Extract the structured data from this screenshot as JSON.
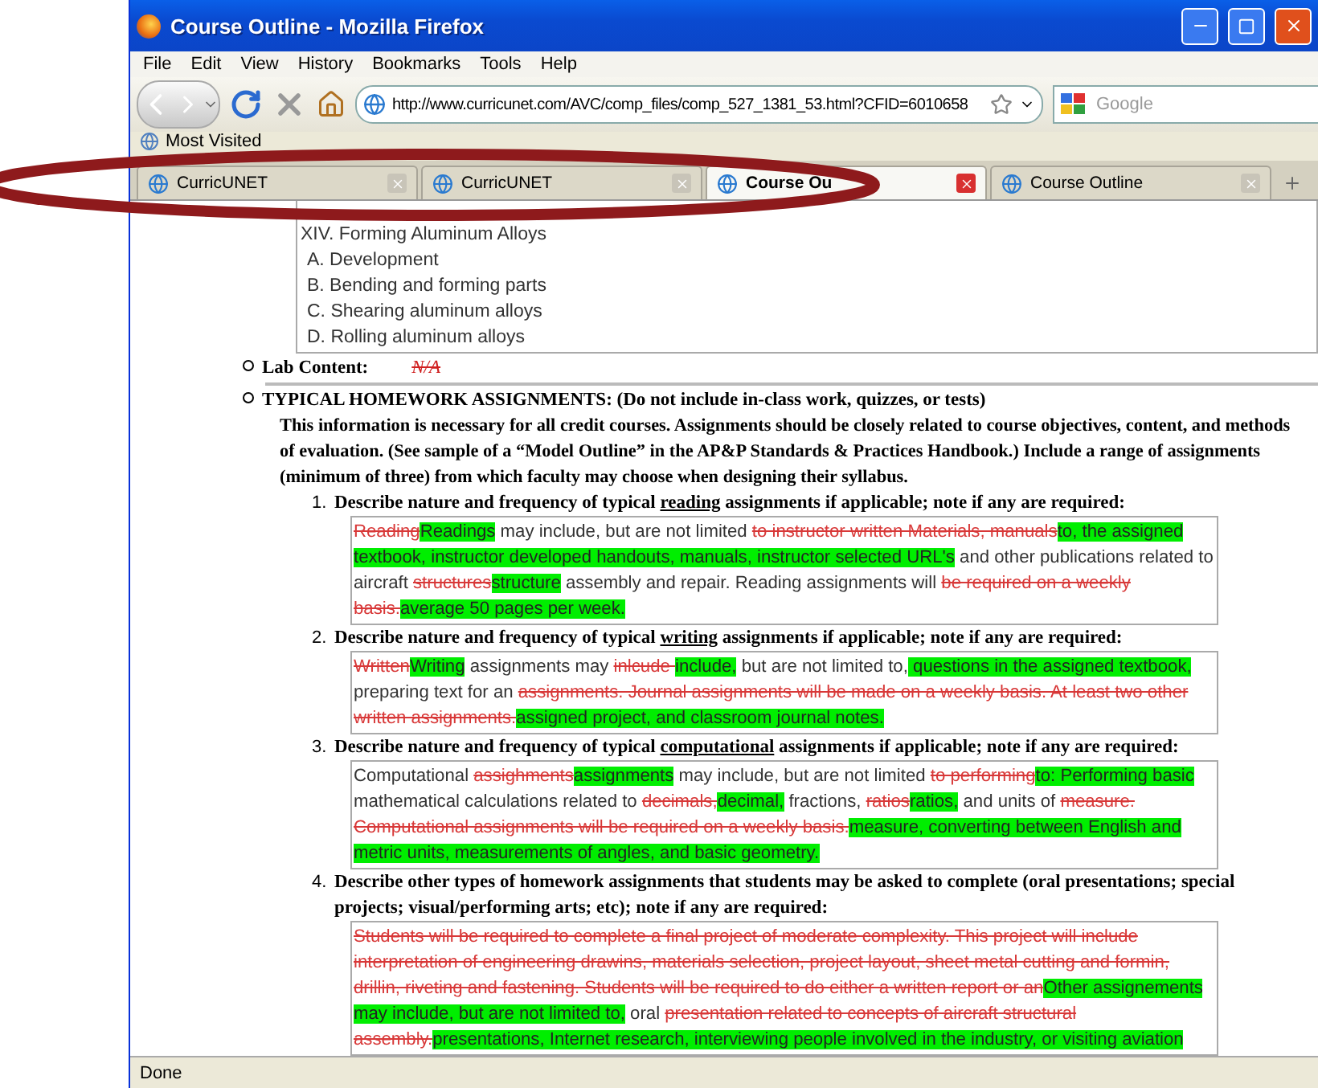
{
  "window": {
    "title": "Course Outline - Mozilla Firefox"
  },
  "menu": [
    "File",
    "Edit",
    "View",
    "History",
    "Bookmarks",
    "Tools",
    "Help"
  ],
  "address": {
    "value": "http://www.curricunet.com/AVC/comp_files/comp_527_1381_53.html?CFID=6010658"
  },
  "search": {
    "placeholder": "Google"
  },
  "bookmarks": [
    "Most Visited"
  ],
  "tabs": [
    {
      "label": "CurricUNET",
      "selected": false
    },
    {
      "label": "CurricUNET",
      "selected": false
    },
    {
      "label": "Course Ou",
      "selected": true
    },
    {
      "label": "Course Outline",
      "selected": false
    }
  ],
  "outline": [
    {
      "text": "XIV. Forming Aluminum Alloys",
      "kind": "main"
    },
    {
      "text": "A. Development",
      "kind": "sub"
    },
    {
      "text": "B. Bending and forming parts",
      "kind": "sub"
    },
    {
      "text": "C. Shearing aluminum alloys",
      "kind": "sub"
    },
    {
      "text": "D. Rolling aluminum alloys",
      "kind": "sub"
    }
  ],
  "lab": {
    "label": "Lab Content:",
    "value": "N/A"
  },
  "homework": {
    "heading": "TYPICAL HOMEWORK ASSIGNMENTS: (Do not include in-class work, quizzes, or tests)",
    "intro": "This information is necessary for all credit courses. Assignments should be closely related to course objectives, content, and methods of evaluation. (See sample of a “Model Outline” in the AP&P Standards & Practices Handbook.) Include a range of assignments (minimum of three) from which faculty may choose when designing their syllabus.",
    "questions": [
      {
        "number": "1.",
        "prompt": [
          {
            "text": "Describe nature and frequency of typical ",
            "underlined": false
          },
          {
            "text": "reading",
            "underlined": true
          },
          {
            "text": " assignments if applicable; note if any are required:",
            "underlined": false
          }
        ],
        "answer": [
          {
            "kind": "del",
            "text": "Reading"
          },
          {
            "kind": "ins",
            "text": "Readings"
          },
          {
            "kind": "plain",
            "text": " may include, but are not limited "
          },
          {
            "kind": "del",
            "text": "to instructor written Materials, manuals"
          },
          {
            "kind": "ins",
            "text": "to, the assigned textbook, instructor developed handouts, manuals, instructor selected URL's"
          },
          {
            "kind": "plain",
            "text": " and other publications related to aircraft "
          },
          {
            "kind": "del",
            "text": "structures"
          },
          {
            "kind": "ins",
            "text": "structure"
          },
          {
            "kind": "plain",
            "text": " assembly and repair. Reading assignments will "
          },
          {
            "kind": "del",
            "text": "be required on a weekly basis."
          },
          {
            "kind": "ins",
            "text": "average 50 pages per week."
          }
        ]
      },
      {
        "number": "2.",
        "prompt": [
          {
            "text": "Describe nature and frequency of typical ",
            "underlined": false
          },
          {
            "text": "writing",
            "underlined": true
          },
          {
            "text": " assignments if applicable; note if any are required:",
            "underlined": false
          }
        ],
        "answer": [
          {
            "kind": "del",
            "text": "Written"
          },
          {
            "kind": "ins",
            "text": "Writing"
          },
          {
            "kind": "plain",
            "text": " assignments may "
          },
          {
            "kind": "del",
            "text": "inlcude "
          },
          {
            "kind": "ins",
            "text": "include,"
          },
          {
            "kind": "plain",
            "text": " but are not limited to,"
          },
          {
            "kind": "ins",
            "text": " questions in the assigned textbook,"
          },
          {
            "kind": "plain",
            "text": " preparing text for an "
          },
          {
            "kind": "del",
            "text": "assignments. Journal assignments will be made on a weekly basis. At least two other written assignments."
          },
          {
            "kind": "ins",
            "text": "assigned project, and classroom journal notes."
          }
        ]
      },
      {
        "number": "3.",
        "prompt": [
          {
            "text": "Describe nature and frequency of typical ",
            "underlined": false
          },
          {
            "text": "computational",
            "underlined": true
          },
          {
            "text": " assignments if applicable; note if any are required:",
            "underlined": false
          }
        ],
        "answer": [
          {
            "kind": "plain",
            "text": "Computational "
          },
          {
            "kind": "del",
            "text": "assighments"
          },
          {
            "kind": "ins",
            "text": "assignments"
          },
          {
            "kind": "plain",
            "text": " may include, but are not limited "
          },
          {
            "kind": "del",
            "text": "to performing"
          },
          {
            "kind": "ins",
            "text": "to: Performing basic"
          },
          {
            "kind": "plain",
            "text": " mathematical calculations related to "
          },
          {
            "kind": "del",
            "text": "decimals,"
          },
          {
            "kind": "ins",
            "text": "decimal,"
          },
          {
            "kind": "plain",
            "text": " fractions, "
          },
          {
            "kind": "del",
            "text": "ratios"
          },
          {
            "kind": "ins",
            "text": "ratios,"
          },
          {
            "kind": "plain",
            "text": " and units of "
          },
          {
            "kind": "del",
            "text": "measure. Computational assignments will be required on a weekly basis."
          },
          {
            "kind": "ins",
            "text": "measure, converting between English and metric units, measurements of angles, and basic geometry."
          }
        ]
      },
      {
        "number": "4.",
        "prompt": [
          {
            "text": "Describe other types of homework assignments that students may be asked to complete (oral presentations; special projects; visual/performing arts; etc); note if any are required:",
            "underlined": false
          }
        ],
        "answer": [
          {
            "kind": "del",
            "text": "Students will be required to complete a final project of moderate complexity. This project will include interpretation of engineering drawins, materials selection, project layout, sheet metal cutting and formin, drillin, riveting and fastening. Students will be required to do either a written report or an"
          },
          {
            "kind": "ins",
            "text": "Other assignements may include, but are not limited to,"
          },
          {
            "kind": "plain",
            "text": " oral "
          },
          {
            "kind": "del",
            "text": "presentation related to concepts of aircraft structural assembly."
          },
          {
            "kind": "ins",
            "text": "presentations, Internet research, interviewing people involved in the industry, or visiting aviation"
          }
        ]
      }
    ]
  },
  "status_bar": {
    "text": "Done"
  }
}
